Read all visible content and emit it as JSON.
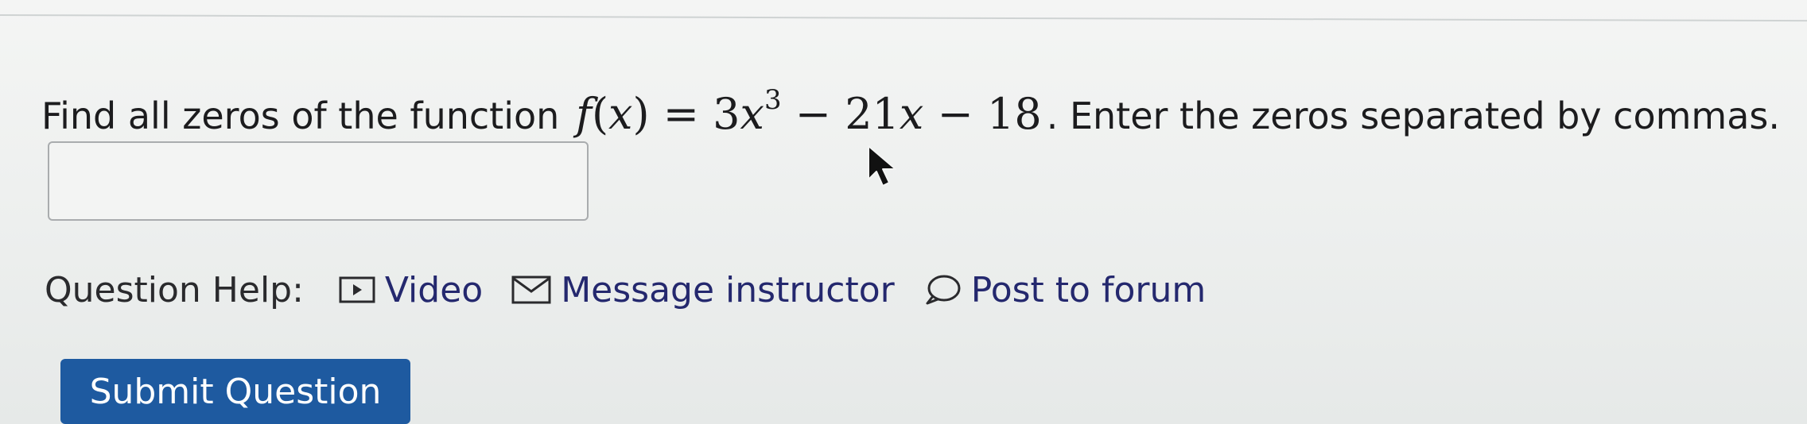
{
  "question": {
    "prefix": "Find all zeros of the function",
    "function_name": "f",
    "variable": "x",
    "equals": "=",
    "term1_coef": "3",
    "term1_exp": "3",
    "minus1": "−",
    "term2_coef": "21",
    "minus2": "−",
    "constant": "18",
    "suffix": ". Enter the zeros separated by commas."
  },
  "answer_input": {
    "value": "",
    "placeholder": ""
  },
  "help": {
    "label": "Question Help:",
    "links": [
      {
        "label": "Video",
        "icon": "video-icon"
      },
      {
        "label": "Message instructor",
        "icon": "envelope-icon"
      },
      {
        "label": "Post to forum",
        "icon": "speech-bubble-icon"
      }
    ]
  },
  "submit": {
    "label": "Submit Question"
  },
  "colors": {
    "link": "#24286e",
    "submit_bg": "#1e5aa0",
    "text": "#1c1c1e"
  }
}
